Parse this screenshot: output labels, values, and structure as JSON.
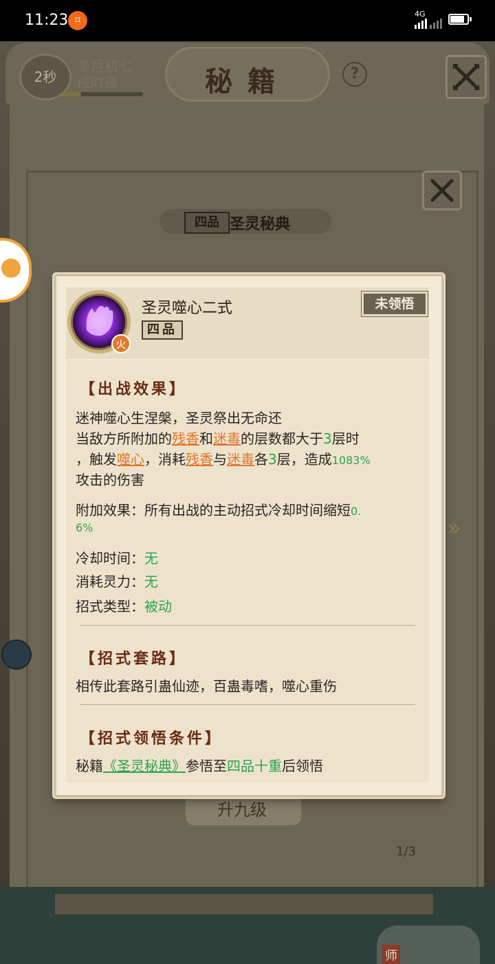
{
  "status_bar": {
    "time": "11:23",
    "network": "4G"
  },
  "header": {
    "timer": "2秒",
    "date_line1": "冬月初七",
    "date_line2": "戌时夜",
    "title": "秘籍",
    "help": "?"
  },
  "book": {
    "grade_label": "四品",
    "title": "圣灵秘典",
    "level_button": "升九级",
    "page": "1/3"
  },
  "bottom": {
    "master_label": "师"
  },
  "skill": {
    "name": "圣灵噬心二式",
    "grade": "四品",
    "status": "未领悟",
    "element": "火",
    "battle_effect_heading": "【出战效果】",
    "effect_line1": "迷神噬心生涅槃，圣灵祭出无命还",
    "line2_a": "当敌方所附加的",
    "link_canxiang": "残香",
    "line2_b": "和",
    "link_midu": "迷毒",
    "line2_c": "的层数都大于",
    "layers_value": "3",
    "line2_d": "层时",
    "line3_a": "，触发",
    "link_shixin": "噬心",
    "line3_b": "，消耗",
    "line3_c": "与",
    "line3_d": "各",
    "line3_e": "层，造成",
    "damage_value": "1083%",
    "effect_line4": "攻击的伤害",
    "extra_effect_label": "附加效果：所有出战的主动招式冷却时间缩短",
    "extra_value_a": "0.",
    "extra_value_b": "6%",
    "cooldown_label": "冷却时间：",
    "cooldown_value": "无",
    "cost_label": "消耗灵力：",
    "cost_value": "无",
    "type_label": "招式类型：",
    "type_value": "被动",
    "routine_heading": "【招式套路】",
    "routine_text": "相传此套路引蛊仙迹，百蛊毒嗜，噬心重伤",
    "condition_heading": "【招式领悟条件】",
    "condition_a": "秘籍",
    "condition_book": "《圣灵秘典》",
    "condition_b": "参悟至",
    "condition_level": "四品十重",
    "condition_c": "后领悟"
  },
  "colors": {
    "heading": "#6a2c14",
    "link_orange": "#e0762b",
    "value_green": "#2ca44d",
    "card_bg": "#f3ead7"
  }
}
